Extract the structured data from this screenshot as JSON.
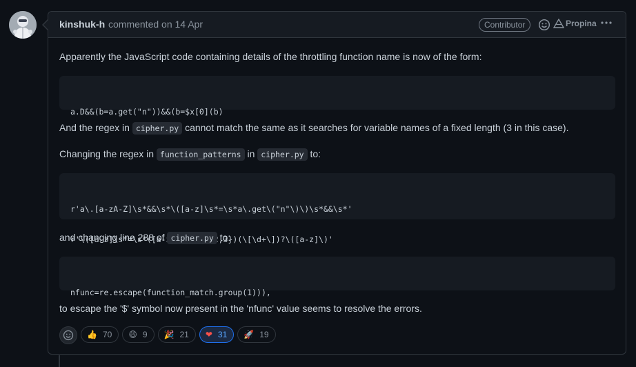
{
  "comment": {
    "author": "kinshuk-h",
    "action_text": "commented on",
    "date": "14 Apr",
    "role_badge": "Contributor",
    "sponsor_label": "Propina",
    "more_icon": "kebab-horizontal-icon"
  },
  "body": {
    "p1": "Apparently the JavaScript code containing details of the throttling function name is now of the form:",
    "code1": [
      "a.D&&(b=a.get(\"n\"))&&(b=$x[0](b)"
    ],
    "p2_a": "And the regex in",
    "p2_code": "cipher.py",
    "p2_b": "cannot match the same as it searches for variable names of a fixed length (3 in this case).",
    "p3_a": "Changing the regex in",
    "p3_code1": "function_patterns",
    "p3_b": "in",
    "p3_code2": "cipher.py",
    "p3_c": "to:",
    "code2": [
      "r'a\\.[a-zA-Z]\\s*&&\\s*\\([a-z]\\s*=\\s*a\\.get\\(\"n\"\\)\\)\\s*&&\\s*'",
      "r'\\([a-z]\\s*=\\s*([a-zA-Z0-9$]{2,3})(\\[\\d+\\])?\\([a-z]\\)'"
    ],
    "p4_a": "and changing line 288 of",
    "p4_code": "cipher.py",
    "p4_b": "to:",
    "code3": [
      "nfunc=re.escape(function_match.group(1))),"
    ],
    "p5": "to escape the '$' symbol now present in the 'nfunc' value seems to resolve the errors."
  },
  "reactions": [
    {
      "icon": "thumbs-up-icon",
      "emoji": "👍",
      "count": "70",
      "active": false
    },
    {
      "icon": "laugh-icon",
      "emoji": "😄",
      "count": "9",
      "active": false
    },
    {
      "icon": "hooray-icon",
      "emoji": "🎉",
      "count": "21",
      "active": false
    },
    {
      "icon": "heart-icon",
      "emoji": "❤",
      "count": "31",
      "active": true
    },
    {
      "icon": "rocket-icon",
      "emoji": "🚀",
      "count": "19",
      "active": false
    }
  ],
  "colors": {
    "background": "#0d1117",
    "header": "#161b22",
    "border": "#30363d",
    "accent": "#58a6ff",
    "heart": "#f85149"
  }
}
